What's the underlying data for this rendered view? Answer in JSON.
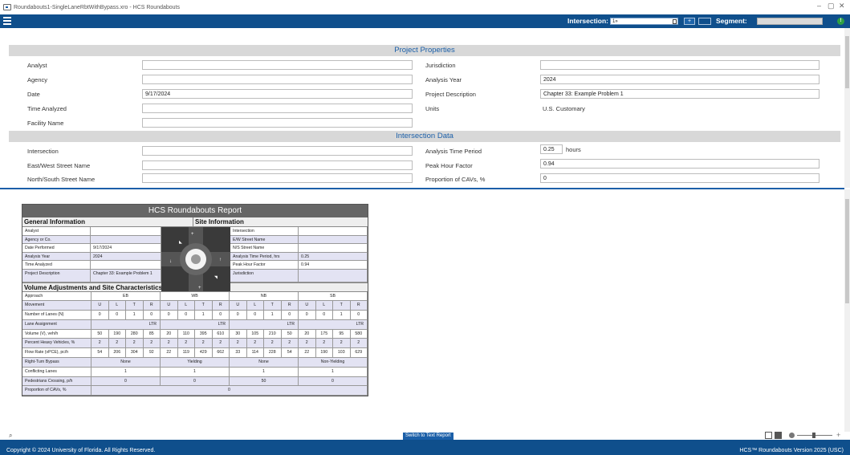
{
  "window": {
    "title": "Roundabouts1-SingleLaneRbtWithBypass.xro - HCS Roundabouts",
    "min_glyph": "–",
    "max_glyph": "▢",
    "close_glyph": "✕"
  },
  "toolbar": {
    "intersection_label": "Intersection:",
    "intersection_value": "1»",
    "add_label": "+",
    "segment_label": "Segment:",
    "info_glyph": "!"
  },
  "project": {
    "section_title": "Project Properties",
    "analyst_label": "Analyst",
    "analyst_value": "",
    "agency_label": "Agency",
    "agency_value": "",
    "date_label": "Date",
    "date_value": "9/17/2024",
    "time_analyzed_label": "Time Analyzed",
    "time_analyzed_value": "",
    "facility_label": "Facility Name",
    "facility_value": "",
    "jurisdiction_label": "Jurisdiction",
    "jurisdiction_value": "",
    "analysis_year_label": "Analysis Year",
    "analysis_year_value": "2024",
    "description_label": "Project Description",
    "description_value": "Chapter 33: Example Problem 1",
    "units_label": "Units",
    "units_value": "U.S. Customary"
  },
  "intersection": {
    "section_title": "Intersection Data",
    "intersection_label": "Intersection",
    "intersection_value": "",
    "ew_label": "East/West Street Name",
    "ew_value": "",
    "ns_label": "North/South Street Name",
    "ns_value": "",
    "period_label": "Analysis Time Period",
    "period_value": "0.25",
    "period_unit": "hours",
    "phf_label": "Peak Hour Factor",
    "phf_value": "0.94",
    "cav_label": "Proportion of CAVs, %",
    "cav_value": "0"
  },
  "report": {
    "title": "HCS Roundabouts Report",
    "general_header": "General Information",
    "site_header": "Site Information",
    "general_rows": [
      {
        "label": "Analyst",
        "value": ""
      },
      {
        "label": "Agency or Co.",
        "value": ""
      },
      {
        "label": "Date Performed",
        "value": "9/17/2024"
      },
      {
        "label": "Analysis Year",
        "value": "2024"
      },
      {
        "label": "Time Analyzed",
        "value": ""
      },
      {
        "label": "Project Description",
        "value": "Chapter 33: Example Problem 1"
      }
    ],
    "site_rows": [
      {
        "label": "Intersection",
        "value": ""
      },
      {
        "label": "E/W Street Name",
        "value": ""
      },
      {
        "label": "N/S Street Name",
        "value": ""
      },
      {
        "label": "Analysis Time Period, hrs",
        "value": "0.25"
      },
      {
        "label": "Peak Hour Factor",
        "value": "0.94"
      },
      {
        "label": "Jurisdiction",
        "value": ""
      }
    ],
    "volume_header": "Volume Adjustments and Site Characteristics",
    "approach_label": "Approach",
    "approaches": [
      "EB",
      "WB",
      "NB",
      "SB"
    ],
    "movement_label": "Movement",
    "movements": [
      "U",
      "L",
      "T",
      "R",
      "U",
      "L",
      "T",
      "R",
      "U",
      "L",
      "T",
      "R",
      "U",
      "L",
      "T",
      "R"
    ],
    "lanes_label": "Number of Lanes (N)",
    "lanes": [
      "0",
      "0",
      "1",
      "0",
      "0",
      "0",
      "1",
      "0",
      "0",
      "0",
      "1",
      "0",
      "0",
      "0",
      "1",
      "0"
    ],
    "assign_label": "Lane Assignment",
    "assignments": [
      "LTR",
      "LTR",
      "LTR",
      "LTR"
    ],
    "volume_label": "Volume (V), veh/h",
    "volumes": [
      "50",
      "190",
      "280",
      "85",
      "20",
      "110",
      "395",
      "610",
      "30",
      "105",
      "210",
      "50",
      "20",
      "175",
      "95",
      "580"
    ],
    "heavy_label": "Percent Heavy Vehicles, %",
    "heavy": [
      "2",
      "2",
      "2",
      "2",
      "2",
      "2",
      "2",
      "2",
      "2",
      "2",
      "2",
      "2",
      "2",
      "2",
      "2",
      "2"
    ],
    "flow_label": "Flow Rate (vPCE), pc/h",
    "flows": [
      "54",
      "206",
      "304",
      "92",
      "22",
      "119",
      "429",
      "662",
      "33",
      "114",
      "228",
      "54",
      "22",
      "190",
      "103",
      "629"
    ],
    "bypass_label": "Right-Turn Bypass",
    "bypass": [
      "None",
      "Yielding",
      "None",
      "Non-Yielding"
    ],
    "conflicting_label": "Conflicting Lanes",
    "conflicting": [
      "1",
      "1",
      "1",
      "1"
    ],
    "ped_label": "Pedestrians Crossing, p/h",
    "ped": [
      "0",
      "0",
      "50",
      "0"
    ],
    "cav_label": "Proportion of CAVs, %",
    "cav": "0"
  },
  "switch_label": "Switch to Text Report",
  "status": {
    "copyright": "Copyright © 2024 University of Florida. All Rights Reserved.",
    "version": "HCS™ Roundabouts Version 2025 (USC)"
  },
  "icons": [
    "hamburger-menu-icon",
    "app-icon",
    "search-zoom-icon",
    "view-single-icon",
    "view-double-icon",
    "zoom-out-icon",
    "zoom-in-icon",
    "info-icon"
  ],
  "colors": {
    "brand_blue": "#0f4f8c",
    "accent_blue": "#1b5fa8",
    "alt_row": "#e3e3f3",
    "report_title_bg": "#666666",
    "info_green": "#2ea043"
  }
}
